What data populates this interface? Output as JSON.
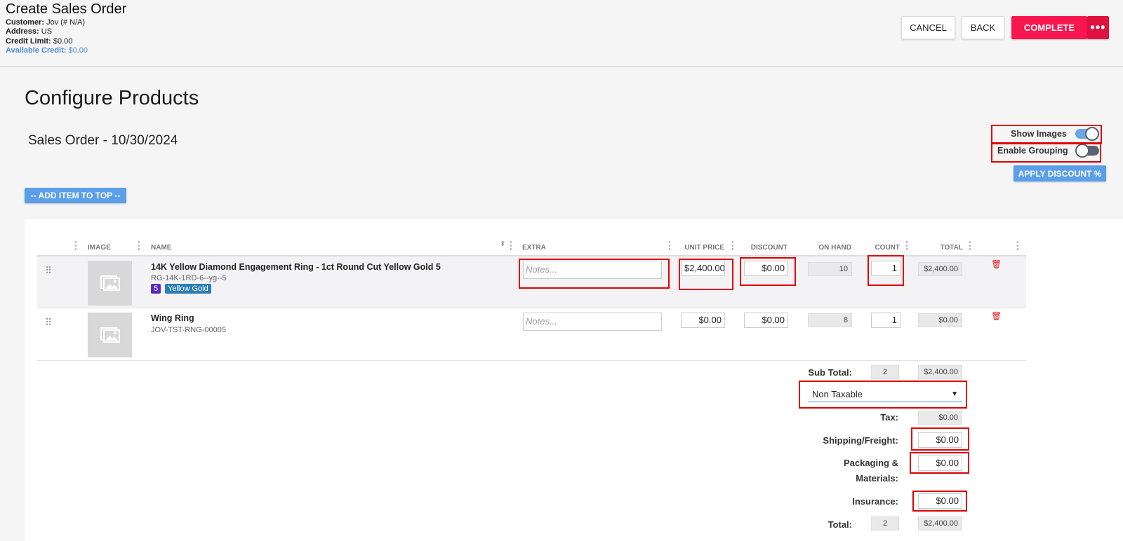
{
  "header": {
    "title": "Create Sales Order",
    "customer_label": "Customer:",
    "customer_value": "Jov (# N/A)",
    "address_label": "Address:",
    "address_value": "US",
    "credit_limit_label": "Credit Limit:",
    "credit_limit_value": "$0.00",
    "available_credit_label": "Available Credit:",
    "available_credit_value": "$0.00",
    "cancel_label": "CANCEL",
    "back_label": "BACK",
    "complete_label": "COMPLETE",
    "more_label": "•••"
  },
  "main": {
    "section_title": "Configure Products",
    "order_title": "Sales Order - 10/30/2024",
    "show_images_label": "Show Images",
    "show_images_on": true,
    "enable_grouping_label": "Enable Grouping",
    "enable_grouping_on": false,
    "apply_discount_label": "APPLY DISCOUNT %",
    "add_item_label": "-- ADD ITEM TO TOP --"
  },
  "table": {
    "columns": {
      "image": "IMAGE",
      "name": "NAME",
      "extra": "EXTRA",
      "unit_price": "UNIT PRICE",
      "discount": "DISCOUNT",
      "on_hand": "ON HAND",
      "count": "COUNT",
      "total": "TOTAL"
    },
    "rows": [
      {
        "name": "14K Yellow Diamond Engagement Ring - 1ct Round Cut Yellow Gold 5",
        "sku": "RG-14K-1RD-6--yg--5",
        "badge_size": "5",
        "badge_metal": "Yellow Gold",
        "notes_placeholder": "Notes...",
        "unit_price": "$2,400.00",
        "discount": "$0.00",
        "on_hand": "10",
        "count": "1",
        "total": "$2,400.00"
      },
      {
        "name": "Wing Ring",
        "sku": "JOV-TST-RNG-00005",
        "notes_placeholder": "Notes...",
        "unit_price": "$0.00",
        "discount": "$0.00",
        "on_hand": "8",
        "count": "1",
        "total": "$0.00"
      }
    ]
  },
  "totals": {
    "subtotal_label": "Sub Total:",
    "subtotal_count": "2",
    "subtotal_value": "$2,400.00",
    "tax_option": "Non Taxable",
    "tax_label": "Tax:",
    "tax_value": "$0.00",
    "shipping_label": "Shipping/Freight:",
    "shipping_value": "$0.00",
    "packaging_label_1": "Packaging &",
    "packaging_label_2": "Materials:",
    "packaging_value": "$0.00",
    "insurance_label": "Insurance:",
    "insurance_value": "$0.00",
    "total_label": "Total:",
    "total_count": "2",
    "total_value": "$2,400.00"
  },
  "colors": {
    "accent_red": "#f7164d",
    "accent_blue": "#5a9fe8",
    "highlight_box": "#e00000",
    "badge_size": "#5b2bb8",
    "badge_metal": "#2a7db5"
  }
}
